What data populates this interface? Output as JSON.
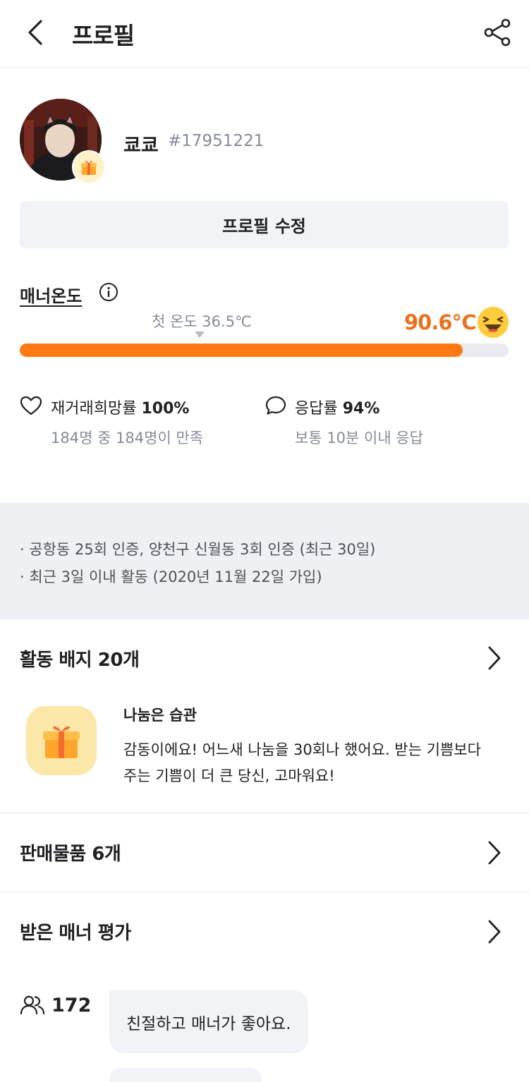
{
  "header": {
    "title": "프로필",
    "back_icon": "chevron-left-icon",
    "share_icon": "share-icon"
  },
  "profile": {
    "nickname": "쿄쿄",
    "user_id": "#17951221",
    "edit_button": "프로필 수정",
    "badge_icon": "gift-icon"
  },
  "manner": {
    "title": "매너온도",
    "first_temp": "첫 온도 36.5℃",
    "temperature": "90.6℃",
    "temperature_value": 90.6,
    "accent_color": "#ff7a13",
    "face_icon": "laughing-face-icon"
  },
  "stats": {
    "rehire_label": "재거래희망률",
    "rehire_value": "100%",
    "rehire_desc": "184명 중 184명이 만족",
    "response_label": "응답률",
    "response_value": "94%",
    "response_desc": "보통 10분 이내 응답"
  },
  "info": {
    "lines": [
      "· 공항동 25회 인증, 양천구 신월동 3회 인증 (최근 30일)",
      "· 최근 3일 이내 활동 (2020년 11월 22일 가입)"
    ]
  },
  "badges": {
    "title": "활동 배지 20개",
    "featured": {
      "name": "나눔은 습관",
      "description": "감동이에요! 어느새 나눔을 30회나 했어요. 받는 기쁨보다 주는 기쁨이 더 큰 당신, 고마워요!",
      "icon": "gift-icon"
    }
  },
  "sales": {
    "title": "판매물품 6개"
  },
  "reviews": {
    "title": "받은 매너 평가",
    "items": [
      {
        "count": "172",
        "text": "친절하고 매너가 좋아요."
      }
    ]
  }
}
